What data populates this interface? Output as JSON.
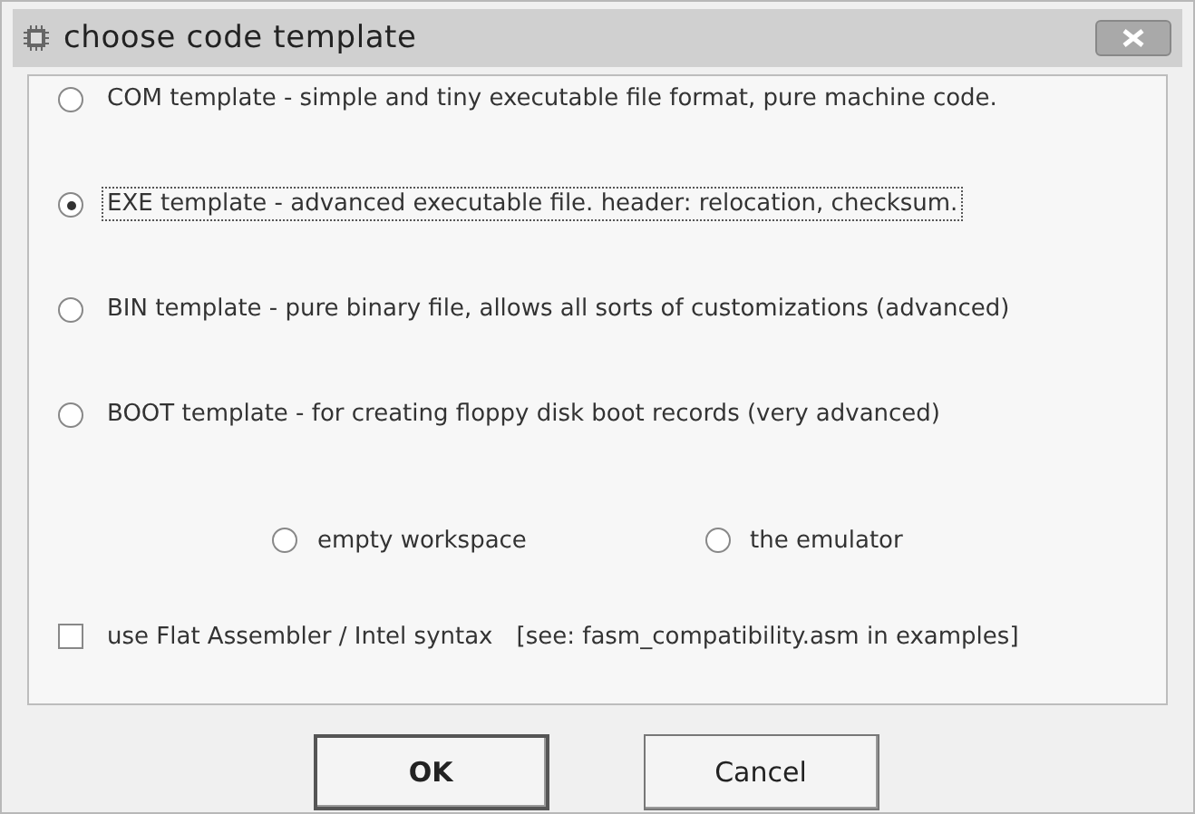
{
  "window": {
    "title": "choose code template"
  },
  "templates": [
    {
      "label": "COM template - simple and tiny executable file format, pure machine code.",
      "selected": false
    },
    {
      "label": "EXE template - advanced executable file. header: relocation, checksum.",
      "selected": true
    },
    {
      "label": "BIN template - pure binary file, allows all sorts of customizations (advanced)",
      "selected": false
    },
    {
      "label": "BOOT template - for creating floppy disk boot records (very advanced)",
      "selected": false
    }
  ],
  "start_options": [
    {
      "label": "empty workspace",
      "selected": false
    },
    {
      "label": "the emulator",
      "selected": false
    }
  ],
  "syntax_checkbox": {
    "label": "use Flat Assembler / Intel syntax",
    "note": "[see: fasm_compatibility.asm in examples]",
    "checked": false
  },
  "buttons": [
    {
      "label": "OK",
      "default": true
    },
    {
      "label": "Cancel",
      "default": false
    }
  ]
}
